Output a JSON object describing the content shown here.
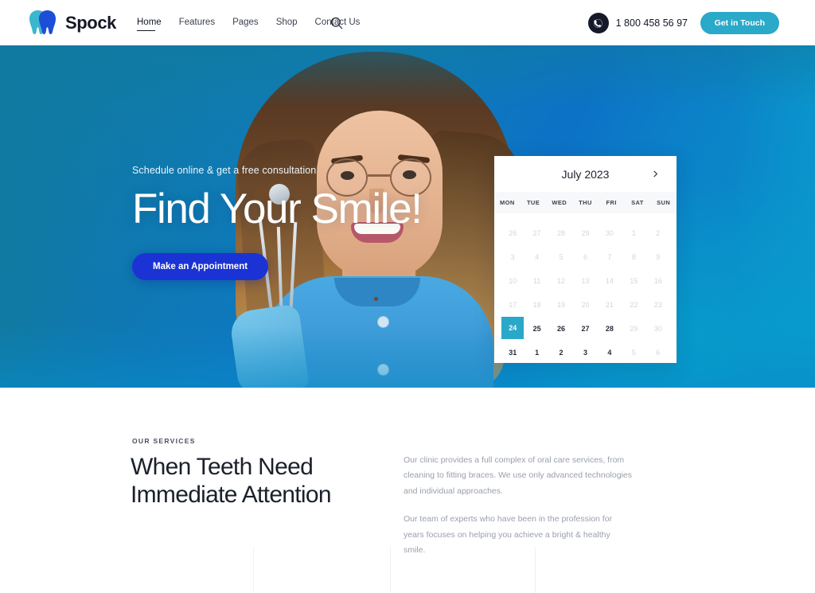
{
  "header": {
    "logo_text": "Spock",
    "logo_icon": "tooth-logo-icon",
    "nav": [
      {
        "label": "Home",
        "active": true
      },
      {
        "label": "Features",
        "active": false
      },
      {
        "label": "Pages",
        "active": false
      },
      {
        "label": "Shop",
        "active": false
      },
      {
        "label": "Contact Us",
        "active": false
      }
    ],
    "search_icon": "search-icon",
    "phone_icon": "phone-icon",
    "phone_number": "1 800 458 56 97",
    "cta_label": "Get in Touch",
    "cta_color": "#2aa9c8"
  },
  "hero": {
    "subtitle": "Schedule online & get a free consultation",
    "title": "Find Your Smile!",
    "button_label": "Make an Appointment",
    "button_color": "#1b33d4",
    "gradient_from": "#117a9e",
    "gradient_to": "#0aa0cc"
  },
  "calendar": {
    "month_label": "July 2023",
    "next_icon": "chevron-right-icon",
    "weekdays": [
      "MON",
      "TUE",
      "WED",
      "THU",
      "FRI",
      "SAT",
      "SUN"
    ],
    "selected_day": "24",
    "selected_color": "#29a8c9",
    "weeks": [
      [
        {
          "d": "26",
          "state": "muted"
        },
        {
          "d": "27",
          "state": "muted"
        },
        {
          "d": "28",
          "state": "muted"
        },
        {
          "d": "29",
          "state": "muted"
        },
        {
          "d": "30",
          "state": "muted"
        },
        {
          "d": "1",
          "state": "muted"
        },
        {
          "d": "2",
          "state": "muted"
        }
      ],
      [
        {
          "d": "3",
          "state": "muted"
        },
        {
          "d": "4",
          "state": "muted"
        },
        {
          "d": "5",
          "state": "muted"
        },
        {
          "d": "6",
          "state": "muted"
        },
        {
          "d": "7",
          "state": "muted"
        },
        {
          "d": "8",
          "state": "muted"
        },
        {
          "d": "9",
          "state": "muted"
        }
      ],
      [
        {
          "d": "10",
          "state": "muted"
        },
        {
          "d": "11",
          "state": "muted"
        },
        {
          "d": "12",
          "state": "muted"
        },
        {
          "d": "13",
          "state": "muted"
        },
        {
          "d": "14",
          "state": "muted"
        },
        {
          "d": "15",
          "state": "muted"
        },
        {
          "d": "16",
          "state": "muted"
        }
      ],
      [
        {
          "d": "17",
          "state": "muted"
        },
        {
          "d": "18",
          "state": "muted"
        },
        {
          "d": "19",
          "state": "muted"
        },
        {
          "d": "20",
          "state": "muted"
        },
        {
          "d": "21",
          "state": "muted"
        },
        {
          "d": "22",
          "state": "muted"
        },
        {
          "d": "23",
          "state": "muted"
        }
      ],
      [
        {
          "d": "24",
          "state": "sel"
        },
        {
          "d": "25",
          "state": "bold"
        },
        {
          "d": "26",
          "state": "bold"
        },
        {
          "d": "27",
          "state": "bold"
        },
        {
          "d": "28",
          "state": "bold"
        },
        {
          "d": "29",
          "state": "muted"
        },
        {
          "d": "30",
          "state": "muted"
        }
      ],
      [
        {
          "d": "31",
          "state": "bold"
        },
        {
          "d": "1",
          "state": "bold"
        },
        {
          "d": "2",
          "state": "bold"
        },
        {
          "d": "3",
          "state": "bold"
        },
        {
          "d": "4",
          "state": "bold"
        },
        {
          "d": "5",
          "state": "muted"
        },
        {
          "d": "6",
          "state": "muted"
        }
      ]
    ]
  },
  "services": {
    "eyebrow": "OUR SERVICES",
    "title_line1": "When Teeth Need",
    "title_line2": "Immediate Attention",
    "paragraph1": "Our clinic provides a full complex of oral care services, from cleaning to fitting braces. We use only advanced technologies and individual approaches.",
    "paragraph2": "Our team of experts who have been in the profession for years focuses on helping you achieve a bright & healthy smile."
  }
}
